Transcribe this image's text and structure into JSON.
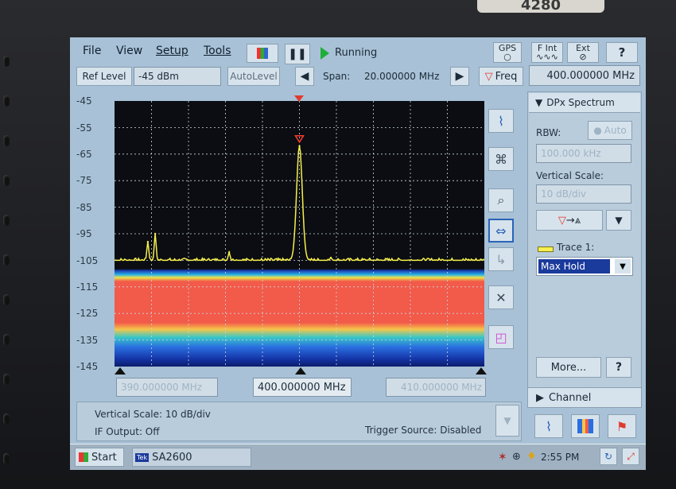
{
  "bezel_label": "4280",
  "menu": {
    "file": "File",
    "view": "View",
    "setup": "Setup",
    "tools": "Tools"
  },
  "run_status": "Running",
  "gps_label": "GPS",
  "fint_label": "F Int",
  "ext_label": "Ext",
  "help_label": "?",
  "ref_level": {
    "label": "Ref Level",
    "value": "-45 dBm"
  },
  "autolevel_label": "AutoLevel",
  "span": {
    "label": "Span:",
    "value": "20.000000 MHz"
  },
  "freq_button": "Freq",
  "center_freq": "400.000000 MHz",
  "dpx_title": "DPx Spectrum",
  "rbw": {
    "label": "RBW:",
    "auto": "Auto",
    "value": "100.000 kHz"
  },
  "vertical_scale": {
    "label": "Vertical Scale:",
    "value": "10 dB/div"
  },
  "trace": {
    "label": "Trace 1:",
    "mode": "Max Hold"
  },
  "more_label": "More...",
  "channel_label": "Channel",
  "y_ticks": [
    "-45",
    "-55",
    "-65",
    "-75",
    "-85",
    "-95",
    "-105",
    "-115",
    "-125",
    "-135",
    "-145"
  ],
  "freq_start": "390.000000 MHz",
  "freq_center": "400.000000 MHz",
  "freq_stop": "410.000000 MHz",
  "status_bar": {
    "vertical_scale": "Vertical Scale: 10 dB/div",
    "if_output": "IF Output: Off",
    "trigger": "Trigger Source: Disabled"
  },
  "taskbar": {
    "start": "Start",
    "app_badge": "Tek",
    "app": "SA2600",
    "clock": "2:55 PM"
  },
  "colors": {
    "trace": "#f6ef4c",
    "marker": "#ff3b2f",
    "band_red": "#f25a4a",
    "screen_bg": "#a8c1d6"
  },
  "chart_data": {
    "type": "line",
    "ylim": [
      -145,
      -45
    ],
    "xlim": [
      390,
      410
    ],
    "x": [
      391.8,
      392.2,
      396.2,
      400.0,
      401.7
    ],
    "values": [
      -98,
      -95,
      -102,
      -62,
      -104
    ],
    "noise_floor": -105
  }
}
